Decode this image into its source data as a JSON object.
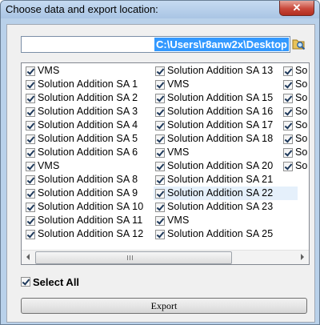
{
  "window": {
    "title": "Choose data and export location:",
    "close_label": "✕"
  },
  "path": {
    "value": "C:\\Users\\r8anw2x\\Desktop"
  },
  "list": {
    "columns": [
      {
        "items": [
          {
            "label": "VMS",
            "checked": true
          },
          {
            "label": "Solution Addition SA 1",
            "checked": true
          },
          {
            "label": "Solution Addition SA 2",
            "checked": true
          },
          {
            "label": "Solution Addition SA 3",
            "checked": true
          },
          {
            "label": "Solution Addition SA 4",
            "checked": true
          },
          {
            "label": "Solution Addition SA 5",
            "checked": true
          },
          {
            "label": "Solution Addition SA 6",
            "checked": true
          },
          {
            "label": "VMS",
            "checked": true
          },
          {
            "label": "Solution Addition SA 8",
            "checked": true
          },
          {
            "label": "Solution Addition SA 9",
            "checked": true
          },
          {
            "label": "Solution Addition SA 10",
            "checked": true
          },
          {
            "label": "Solution Addition SA 11",
            "checked": true
          },
          {
            "label": "Solution Addition SA 12",
            "checked": true
          }
        ]
      },
      {
        "items": [
          {
            "label": "Solution Addition SA 13",
            "checked": true
          },
          {
            "label": "VMS",
            "checked": true
          },
          {
            "label": "Solution Addition SA 15",
            "checked": true
          },
          {
            "label": "Solution Addition SA 16",
            "checked": true
          },
          {
            "label": "Solution Addition SA 17",
            "checked": true
          },
          {
            "label": "Solution Addition SA 18",
            "checked": true
          },
          {
            "label": "VMS",
            "checked": true
          },
          {
            "label": "Solution Addition SA 20",
            "checked": true
          },
          {
            "label": "Solution Addition SA 21",
            "checked": true
          },
          {
            "label": "Solution Addition SA 22",
            "checked": true,
            "highlighted": true
          },
          {
            "label": "Solution Addition SA 23",
            "checked": true
          },
          {
            "label": "VMS",
            "checked": true
          },
          {
            "label": "Solution Addition SA 25",
            "checked": true
          }
        ]
      },
      {
        "items": [
          {
            "label": "So",
            "checked": true
          },
          {
            "label": "So",
            "checked": true
          },
          {
            "label": "So",
            "checked": true
          },
          {
            "label": "So",
            "checked": true
          },
          {
            "label": "So",
            "checked": true
          },
          {
            "label": "So",
            "checked": true
          },
          {
            "label": "So",
            "checked": true
          },
          {
            "label": "So",
            "checked": true
          }
        ]
      }
    ]
  },
  "select_all": {
    "label": "Select All",
    "checked": true
  },
  "export": {
    "label": "Export"
  }
}
